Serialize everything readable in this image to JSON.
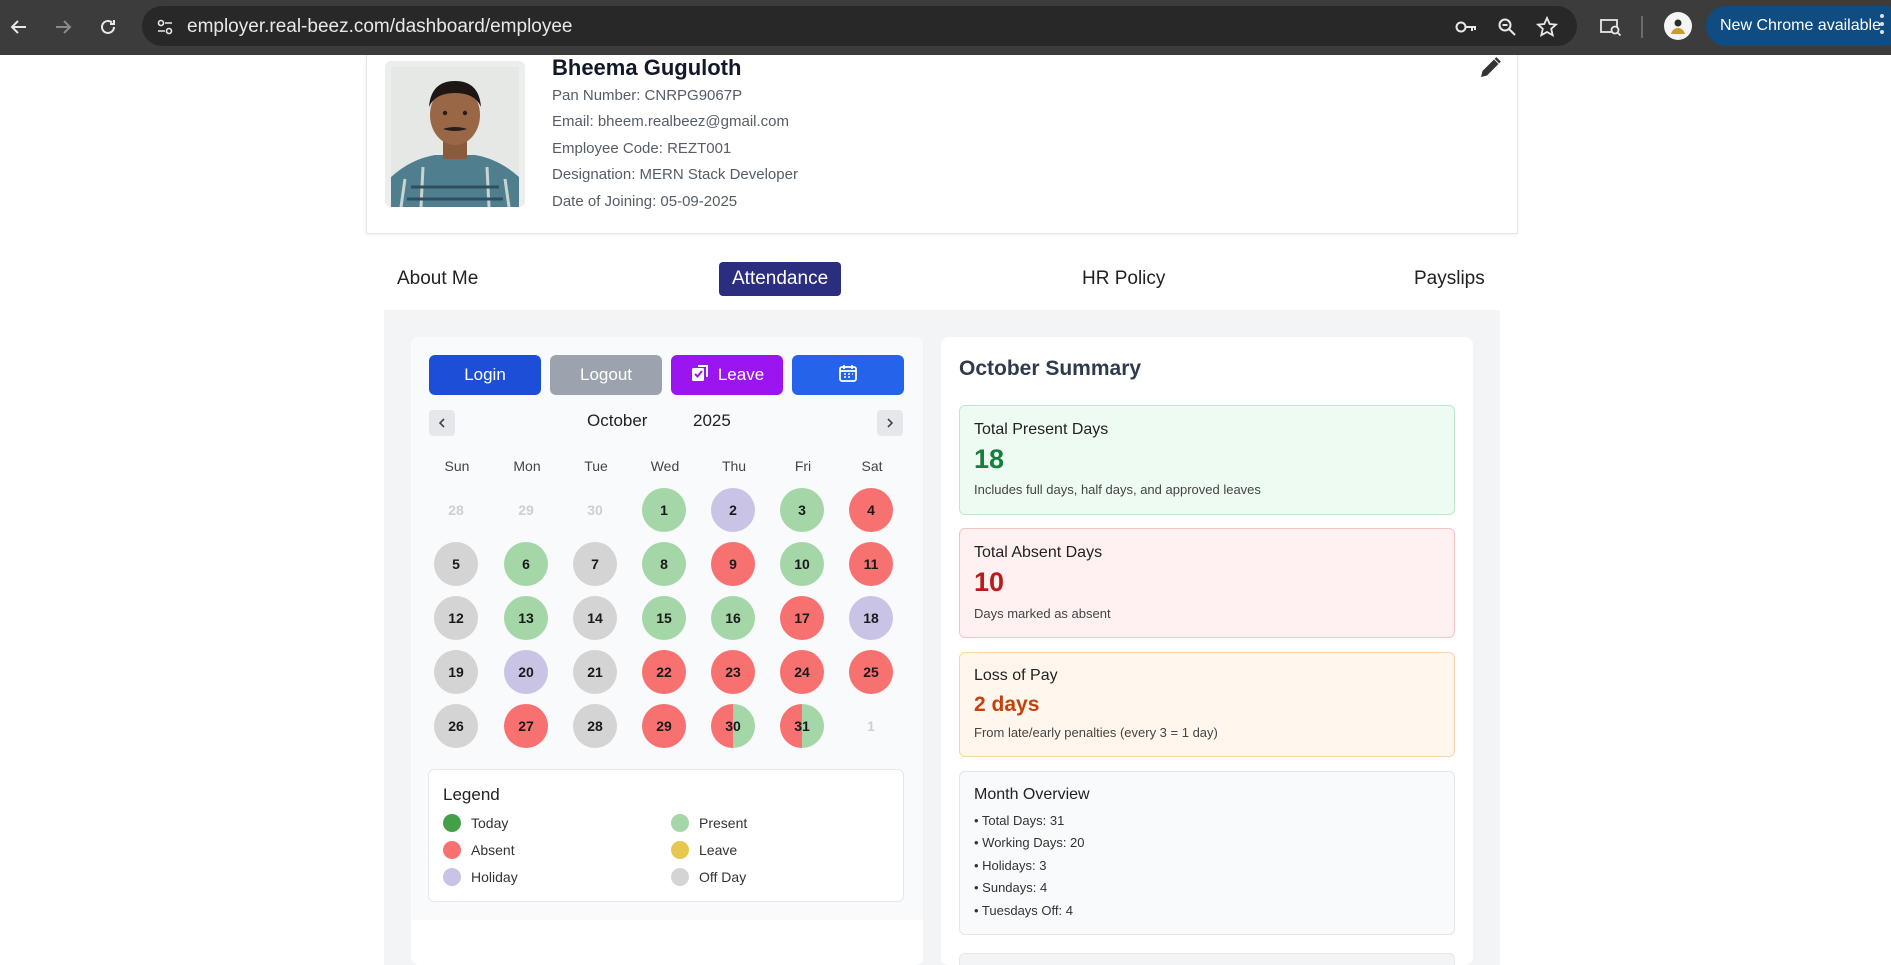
{
  "browser": {
    "url": "employer.real-beez.com/dashboard/employee",
    "update_label": "New Chrome available"
  },
  "profile": {
    "name": "Bheema Guguloth",
    "pan": "Pan Number: CNRPG9067P",
    "email": "Email: bheem.realbeez@gmail.com",
    "employee_code": "Employee Code: REZT001",
    "designation": "Designation: MERN Stack Developer",
    "date_of_joining": "Date of Joining: 05-09-2025"
  },
  "tabs": [
    {
      "label": "About Me",
      "active": false
    },
    {
      "label": "Attendance",
      "active": true
    },
    {
      "label": "HR Policy",
      "active": false
    },
    {
      "label": "Payslips",
      "active": false
    }
  ],
  "actions": {
    "login": "Login",
    "logout": "Logout",
    "leave": "Leave"
  },
  "calendar": {
    "month": "October",
    "year": "2025",
    "weekdays": [
      "Sun",
      "Mon",
      "Tue",
      "Wed",
      "Thu",
      "Fri",
      "Sat"
    ],
    "weeks": [
      [
        {
          "d": "28",
          "s": "muted"
        },
        {
          "d": "29",
          "s": "muted"
        },
        {
          "d": "30",
          "s": "muted"
        },
        {
          "d": "1",
          "s": "present"
        },
        {
          "d": "2",
          "s": "holiday"
        },
        {
          "d": "3",
          "s": "present"
        },
        {
          "d": "4",
          "s": "absent"
        }
      ],
      [
        {
          "d": "5",
          "s": "off"
        },
        {
          "d": "6",
          "s": "present"
        },
        {
          "d": "7",
          "s": "off"
        },
        {
          "d": "8",
          "s": "present"
        },
        {
          "d": "9",
          "s": "absent"
        },
        {
          "d": "10",
          "s": "present"
        },
        {
          "d": "11",
          "s": "absent"
        }
      ],
      [
        {
          "d": "12",
          "s": "off"
        },
        {
          "d": "13",
          "s": "present"
        },
        {
          "d": "14",
          "s": "off"
        },
        {
          "d": "15",
          "s": "present"
        },
        {
          "d": "16",
          "s": "present"
        },
        {
          "d": "17",
          "s": "absent"
        },
        {
          "d": "18",
          "s": "holiday"
        }
      ],
      [
        {
          "d": "19",
          "s": "off"
        },
        {
          "d": "20",
          "s": "holiday"
        },
        {
          "d": "21",
          "s": "off"
        },
        {
          "d": "22",
          "s": "absent"
        },
        {
          "d": "23",
          "s": "absent"
        },
        {
          "d": "24",
          "s": "absent"
        },
        {
          "d": "25",
          "s": "absent"
        }
      ],
      [
        {
          "d": "26",
          "s": "off"
        },
        {
          "d": "27",
          "s": "absent"
        },
        {
          "d": "28",
          "s": "off"
        },
        {
          "d": "29",
          "s": "absent"
        },
        {
          "d": "30",
          "s": "half-ap"
        },
        {
          "d": "31",
          "s": "half-ap"
        },
        {
          "d": "1",
          "s": "muted"
        }
      ]
    ]
  },
  "legend": {
    "title": "Legend",
    "items": [
      {
        "label": "Today",
        "color": "#43a047"
      },
      {
        "label": "Present",
        "color": "#a5d6a7"
      },
      {
        "label": "Absent",
        "color": "#f87171"
      },
      {
        "label": "Leave",
        "color": "#e6c84f"
      },
      {
        "label": "Holiday",
        "color": "#c9c3e6"
      },
      {
        "label": "Off Day",
        "color": "#d4d4d4"
      }
    ]
  },
  "colors": {
    "present": "#a5d6a7",
    "absent": "#f87171",
    "holiday": "#c9c3e6",
    "off": "#d4d4d4",
    "login": "#1d4ed8",
    "logout": "#9ca3af",
    "leave": "#9b15f0",
    "calendar": "#2563eb",
    "tab_active": "#2b2d7f"
  },
  "summary": {
    "title": "October Summary",
    "present": {
      "label": "Total Present Days",
      "value": "18",
      "note": "Includes full days, half days, and approved leaves"
    },
    "absent": {
      "label": "Total Absent Days",
      "value": "10",
      "note": "Days marked as absent"
    },
    "lop": {
      "label": "Loss of Pay",
      "value": "2 days",
      "note": "From late/early penalties (every 3 = 1 day)"
    },
    "overview": {
      "label": "Month Overview",
      "lines": [
        "• Total Days: 31",
        "• Working Days: 20",
        "• Holidays: 3",
        "• Sundays: 4",
        "• Tuesdays Off: 4"
      ]
    }
  }
}
